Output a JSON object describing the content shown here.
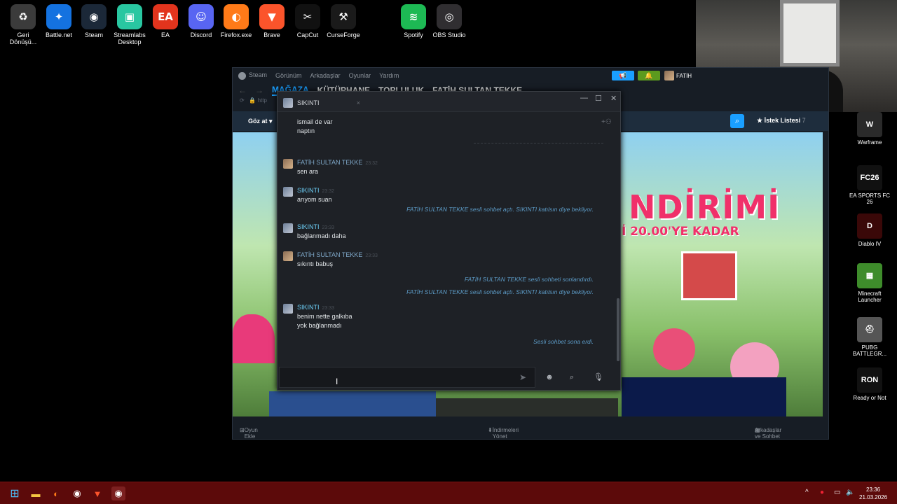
{
  "desktop": {
    "icons": [
      {
        "label": "Geri Dönüşü...",
        "glyph": "♻",
        "color": "#3b3b3b"
      },
      {
        "label": "Battle.net",
        "glyph": "✦",
        "color": "#1472e0"
      },
      {
        "label": "Steam",
        "glyph": "◉",
        "color": "#1b2838"
      },
      {
        "label": "Streamlabs Desktop",
        "glyph": "▣",
        "color": "#29c7a1"
      },
      {
        "label": "EA",
        "glyph": "EA",
        "color": "#e2341d"
      },
      {
        "label": "Discord",
        "glyph": "☺",
        "color": "#5865f2"
      },
      {
        "label": "Firefox.exe",
        "glyph": "◐",
        "color": "#ff7a18"
      },
      {
        "label": "Brave",
        "glyph": "▼",
        "color": "#fb542b"
      },
      {
        "label": "CapCut",
        "glyph": "✂",
        "color": "#111111"
      },
      {
        "label": "CurseForge",
        "glyph": "⚒",
        "color": "#1a1a1a"
      },
      {
        "label": "Spotify",
        "glyph": "≋",
        "color": "#1db954"
      },
      {
        "label": "OBS Studio",
        "glyph": "◎",
        "color": "#302e31"
      }
    ],
    "right_icons": [
      {
        "label": "Warframe",
        "glyph": "W",
        "color": "#2a2a2a"
      },
      {
        "label": "EA SPORTS FC 26",
        "glyph": "FC26",
        "color": "#111111"
      },
      {
        "label": "Diablo IV",
        "glyph": "D",
        "color": "#3a0808"
      },
      {
        "label": "Minecraft Launcher",
        "glyph": "▦",
        "color": "#3e8c2b"
      },
      {
        "label": "PUBG BATTLEGR...",
        "glyph": "⛑",
        "color": "#555555"
      },
      {
        "label": "Ready or Not",
        "glyph": "RON",
        "color": "#111111"
      }
    ]
  },
  "steam": {
    "menu": [
      "Steam",
      "Görünüm",
      "Arkadaşlar",
      "Oyunlar",
      "Yardım"
    ],
    "nav": [
      "MAĞAZA",
      "KÜTÜPHANE",
      "TOPLULUK",
      "FATİH SULTAN TEKKE"
    ],
    "url_prefix": "http",
    "store_browse": "Göz at",
    "wishlist": "İstek Listesi",
    "wishlist_count": "7",
    "account_name": "FATİH",
    "hero_title": "NDİRİMİ",
    "hero_sub": "İ 20.00'YE KADAR",
    "bottom": {
      "add_game": "Oyun Ekle",
      "downloads": "İndirmeleri Yönet",
      "friends": "Arkadaşlar ve Sohbet"
    }
  },
  "chat": {
    "tab_name": "SIKINTI",
    "messages": [
      {
        "type": "cont",
        "lines": [
          "ismail de var",
          "naptın"
        ]
      },
      {
        "type": "msg",
        "name": "FATİH SULTAN TEKKE",
        "time": "23:32",
        "lines": [
          "sen ara"
        ],
        "self": true
      },
      {
        "type": "msg",
        "name": "SIKINTI",
        "time": "23:32",
        "lines": [
          "arıyom suan"
        ],
        "self": false
      },
      {
        "type": "sys",
        "text": "FATİH SULTAN TEKKE sesli sohbet açtı. SIKINTI katılsın diye bekliyor."
      },
      {
        "type": "msg",
        "name": "SIKINTI",
        "time": "23:33",
        "lines": [
          "bağlanmadı daha"
        ],
        "self": false
      },
      {
        "type": "msg",
        "name": "FATİH SULTAN TEKKE",
        "time": "23:33",
        "lines": [
          "sıkıntı babuş"
        ],
        "self": true
      },
      {
        "type": "sys",
        "text": "FATİH SULTAN TEKKE sesli sohbeti sonlandırdı."
      },
      {
        "type": "sys",
        "text": "FATİH SULTAN TEKKE sesli sohbet açtı. SIKINTI katılsın diye bekliyor."
      },
      {
        "type": "msg",
        "name": "SIKINTI",
        "time": "23:33",
        "lines": [
          "benim nette galkıba",
          "yok bağlanmadı"
        ],
        "self": false
      },
      {
        "type": "sys",
        "text": "Sesli sohbet sona erdi."
      }
    ],
    "input_value": ""
  },
  "taskbar": {
    "time": "23:36",
    "date": "21.03.2026"
  }
}
